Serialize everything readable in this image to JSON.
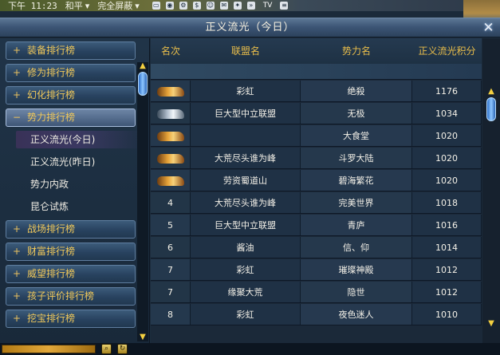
{
  "topbar": {
    "time": "下午 11:23",
    "mode_label": "和平",
    "screen_label": "完全屏蔽",
    "tv_label": "TV",
    "caret": "▾"
  },
  "window": {
    "title": "正义流光（今日）",
    "close_symbol": "✕"
  },
  "sidebar": {
    "categories_top": [
      {
        "symbol": "+",
        "label": "装备排行榜"
      },
      {
        "symbol": "+",
        "label": "修为排行榜"
      },
      {
        "symbol": "+",
        "label": "幻化排行榜"
      },
      {
        "symbol": "−",
        "label": "势力排行榜"
      }
    ],
    "sub_items": [
      {
        "label": "正义流光(今日)"
      },
      {
        "label": "正义流光(昨日)"
      },
      {
        "label": "势力内政"
      },
      {
        "label": "昆仑试炼"
      }
    ],
    "categories_bottom": [
      {
        "symbol": "+",
        "label": "战场排行榜"
      },
      {
        "symbol": "+",
        "label": "财富排行榜"
      },
      {
        "symbol": "+",
        "label": "威望排行榜"
      },
      {
        "symbol": "+",
        "label": "孩子评价排行榜"
      },
      {
        "symbol": "+",
        "label": "挖宝排行榜"
      }
    ]
  },
  "table": {
    "headers": [
      "名次",
      "联盟名",
      "势力名",
      "正义流光积分"
    ],
    "rows": [
      {
        "rank": "",
        "rank_icon": "gold-tiger-icon",
        "alliance": "彩虹",
        "faction": "绝殺",
        "score": "1176"
      },
      {
        "rank": "",
        "rank_icon": "silver-tiger-icon",
        "alliance": "巨大型中立联盟",
        "faction": "无极",
        "score": "1034"
      },
      {
        "rank": "",
        "rank_icon": "gold-tiger-icon",
        "alliance": "",
        "faction": "大食堂",
        "score": "1020"
      },
      {
        "rank": "",
        "rank_icon": "gold-tiger-icon",
        "alliance": "大荒尽头谁为峰",
        "faction": "斗罗大陆",
        "score": "1020"
      },
      {
        "rank": "",
        "rank_icon": "gold-tiger-icon",
        "alliance": "劳资蜀道山",
        "faction": "碧海繁花",
        "score": "1020"
      },
      {
        "rank": "4",
        "rank_icon": "",
        "alliance": "大荒尽头谁为峰",
        "faction": "完美世界",
        "score": "1018"
      },
      {
        "rank": "5",
        "rank_icon": "",
        "alliance": "巨大型中立联盟",
        "faction": "青庐",
        "score": "1016"
      },
      {
        "rank": "6",
        "rank_icon": "",
        "alliance": "酱油",
        "faction": "信、仰",
        "score": "1014"
      },
      {
        "rank": "7",
        "rank_icon": "",
        "alliance": "彩虹",
        "faction": "璀璨神殿",
        "score": "1012"
      },
      {
        "rank": "7",
        "rank_icon": "",
        "alliance": "缘聚大荒",
        "faction": "隐世",
        "score": "1012"
      },
      {
        "rank": "8",
        "rank_icon": "",
        "alliance": "彩虹",
        "faction": "夜色迷人",
        "score": "1010"
      }
    ]
  },
  "scroll": {
    "up": "▲",
    "down": "▼"
  },
  "bottombar": {
    "search_symbol": "⌕",
    "refresh_symbol": "↻"
  },
  "colors": {
    "accent_gold": "#e9bd4a",
    "panel_bg": "#1b2939"
  }
}
